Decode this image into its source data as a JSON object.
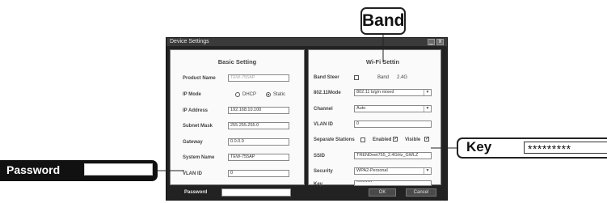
{
  "window": {
    "title": "Device Settings",
    "minimize": "_",
    "close": "x"
  },
  "basic": {
    "title": "Basic Setting",
    "product_name_label": "Product Name",
    "product_name": "TEW-755AP",
    "ip_mode_label": "IP Mode",
    "dhcp_label": "DHCP",
    "static_label": "Static",
    "ip_mode_selected": "Static",
    "ip_address_label": "IP Address",
    "ip_address": "192.168.10.100",
    "subnet_mask_label": "Subnet Mask",
    "subnet_mask": "255.255.255.0",
    "gateway_label": "Gateway",
    "gateway": "0.0.0.0",
    "system_name_label": "System Name",
    "system_name": "TEW-755AP",
    "vlan_id_label": "VLAN ID",
    "vlan_id": "0"
  },
  "wifi": {
    "title": "Wi-Fi Settin",
    "band_steer_label": "Band Steer",
    "band_steer_checked": false,
    "band_label": "Band",
    "band_value": "2.4G",
    "mode_label": "802.11Mode",
    "mode_value": "802.11 b/g/n mixed",
    "channel_label": "Channel",
    "channel_value": "Auto",
    "vlan_id_label": "VLAN ID",
    "vlan_id": "0",
    "separate_stations_label": "Separate Stations",
    "separate_stations_checked": false,
    "enabled_label": "Enabled",
    "enabled_checked": true,
    "check_mark": "✓",
    "visible_label": "Visible",
    "visible_checked": true,
    "ssid_label": "SSID",
    "ssid": "TRENDnet755_2.4GHz_GWLZ",
    "security_label": "Security",
    "security_value": "WPA2-Personal",
    "key_label": "Key",
    "key_value": "**********",
    "dropdown_arrow": "▼"
  },
  "footer": {
    "password_label": "Password",
    "password_value": "",
    "ok_label": "OK",
    "cancel_label": "Cancel"
  },
  "callouts": {
    "band": "Band",
    "key_label": "Key",
    "key_value": "*********",
    "password_label": "Password"
  }
}
